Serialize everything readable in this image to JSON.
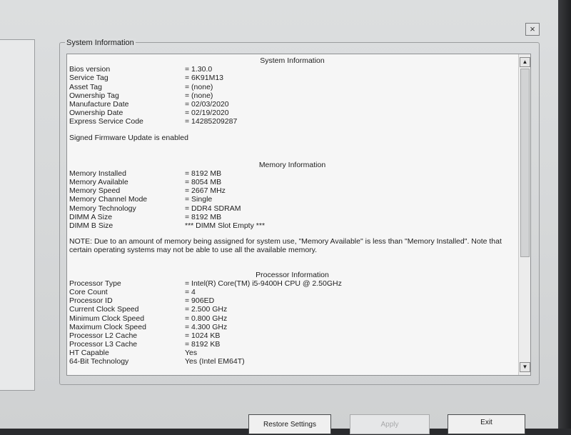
{
  "window": {
    "close_label": "×"
  },
  "group_title": "System Information",
  "sections": {
    "system": {
      "title": "System Information",
      "rows": [
        {
          "label": "Bios version",
          "value": "= 1.30.0"
        },
        {
          "label": "Service Tag",
          "value": "= 6K91M13"
        },
        {
          "label": "Asset Tag",
          "value": "= (none)"
        },
        {
          "label": "Ownership Tag",
          "value": "= (none)"
        },
        {
          "label": "Manufacture Date",
          "value": "= 02/03/2020"
        },
        {
          "label": "Ownership Date",
          "value": "= 02/19/2020"
        },
        {
          "label": "Express Service Code",
          "value": "= 14285209287"
        }
      ],
      "note": "Signed Firmware Update is enabled"
    },
    "memory": {
      "title": "Memory Information",
      "rows": [
        {
          "label": "Memory Installed",
          "value": "= 8192 MB"
        },
        {
          "label": "Memory Available",
          "value": "= 8054 MB"
        },
        {
          "label": "Memory Speed",
          "value": "= 2667 MHz"
        },
        {
          "label": "Memory Channel Mode",
          "value": "= Single"
        },
        {
          "label": "Memory Technology",
          "value": "= DDR4 SDRAM"
        },
        {
          "label": "DIMM A Size",
          "value": "= 8192 MB"
        },
        {
          "label": "DIMM B Size",
          "value": "*** DIMM Slot Empty ***"
        }
      ],
      "note": "NOTE: Due to an amount of memory being assigned for system use, \"Memory Available\" is less than \"Memory Installed\". Note that certain operating systems may not be able to use all the available memory."
    },
    "processor": {
      "title": "Processor Information",
      "rows": [
        {
          "label": "Processor Type",
          "value": "= Intel(R) Core(TM) i5-9400H CPU @ 2.50GHz"
        },
        {
          "label": "Core Count",
          "value": "= 4"
        },
        {
          "label": "Processor ID",
          "value": "= 906ED"
        },
        {
          "label": "Current Clock Speed",
          "value": "= 2.500 GHz"
        },
        {
          "label": "Minimum Clock Speed",
          "value": "= 0.800 GHz"
        },
        {
          "label": "Maximum Clock Speed",
          "value": "= 4.300 GHz"
        },
        {
          "label": "Processor L2 Cache",
          "value": "= 1024 KB"
        },
        {
          "label": "Processor L3 Cache",
          "value": "= 8192 KB"
        },
        {
          "label": "HT Capable",
          "value": "Yes"
        },
        {
          "label": "64-Bit Technology",
          "value": "Yes (Intel EM64T)"
        }
      ]
    }
  },
  "scrollbar": {
    "up_icon": "▲",
    "down_icon": "▼"
  },
  "buttons": {
    "restore": "Restore Settings",
    "apply": "Apply",
    "exit": "Exit"
  }
}
